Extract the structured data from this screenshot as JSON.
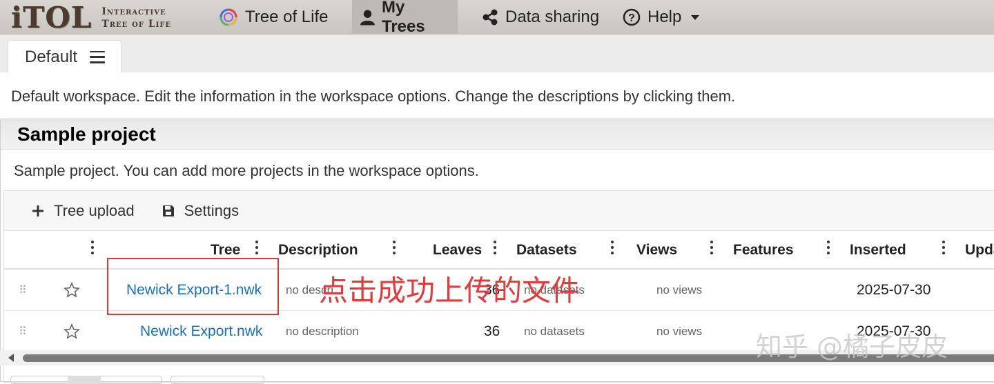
{
  "navbar": {
    "logo_main": "iTOL",
    "logo_sub_1": "Interactive",
    "logo_sub_2": "Tree of Life",
    "items": [
      {
        "label": "Tree of Life",
        "icon": "tree-of-life-circle-icon"
      },
      {
        "label": "My Trees",
        "icon": "user-icon",
        "active": true
      },
      {
        "label": "Data sharing",
        "icon": "share-icon"
      },
      {
        "label": "Help",
        "icon": "help-circle-icon"
      }
    ]
  },
  "workspace": {
    "tab_label": "Default",
    "description": "Default workspace. Edit the information in the workspace options. Change the descriptions by clicking them."
  },
  "project": {
    "title": "Sample project",
    "description": "Sample project. You can add more projects in the workspace options.",
    "toolbar": {
      "upload_label": "Tree upload",
      "settings_label": "Settings"
    },
    "columns": [
      "Tree",
      "Description",
      "Leaves",
      "Datasets",
      "Views",
      "Features",
      "Inserted",
      "Upda"
    ],
    "rows": [
      {
        "tree": "Newick Export-1.nwk",
        "description": "no descri",
        "leaves": "36",
        "datasets": "no datasets",
        "views": "no views",
        "inserted": "2025-07-30"
      },
      {
        "tree": "Newick Export.nwk",
        "description": "no description",
        "leaves": "36",
        "datasets": "no datasets",
        "views": "no views",
        "inserted": "2025-07-30"
      }
    ]
  },
  "annotation": {
    "text": "点击成功上传的文件",
    "color": "#e23b3b"
  },
  "watermark": "知乎 @橘子皮皮",
  "colors": {
    "link": "#1a6fbf",
    "navbar_bg": "#cfccc8"
  }
}
